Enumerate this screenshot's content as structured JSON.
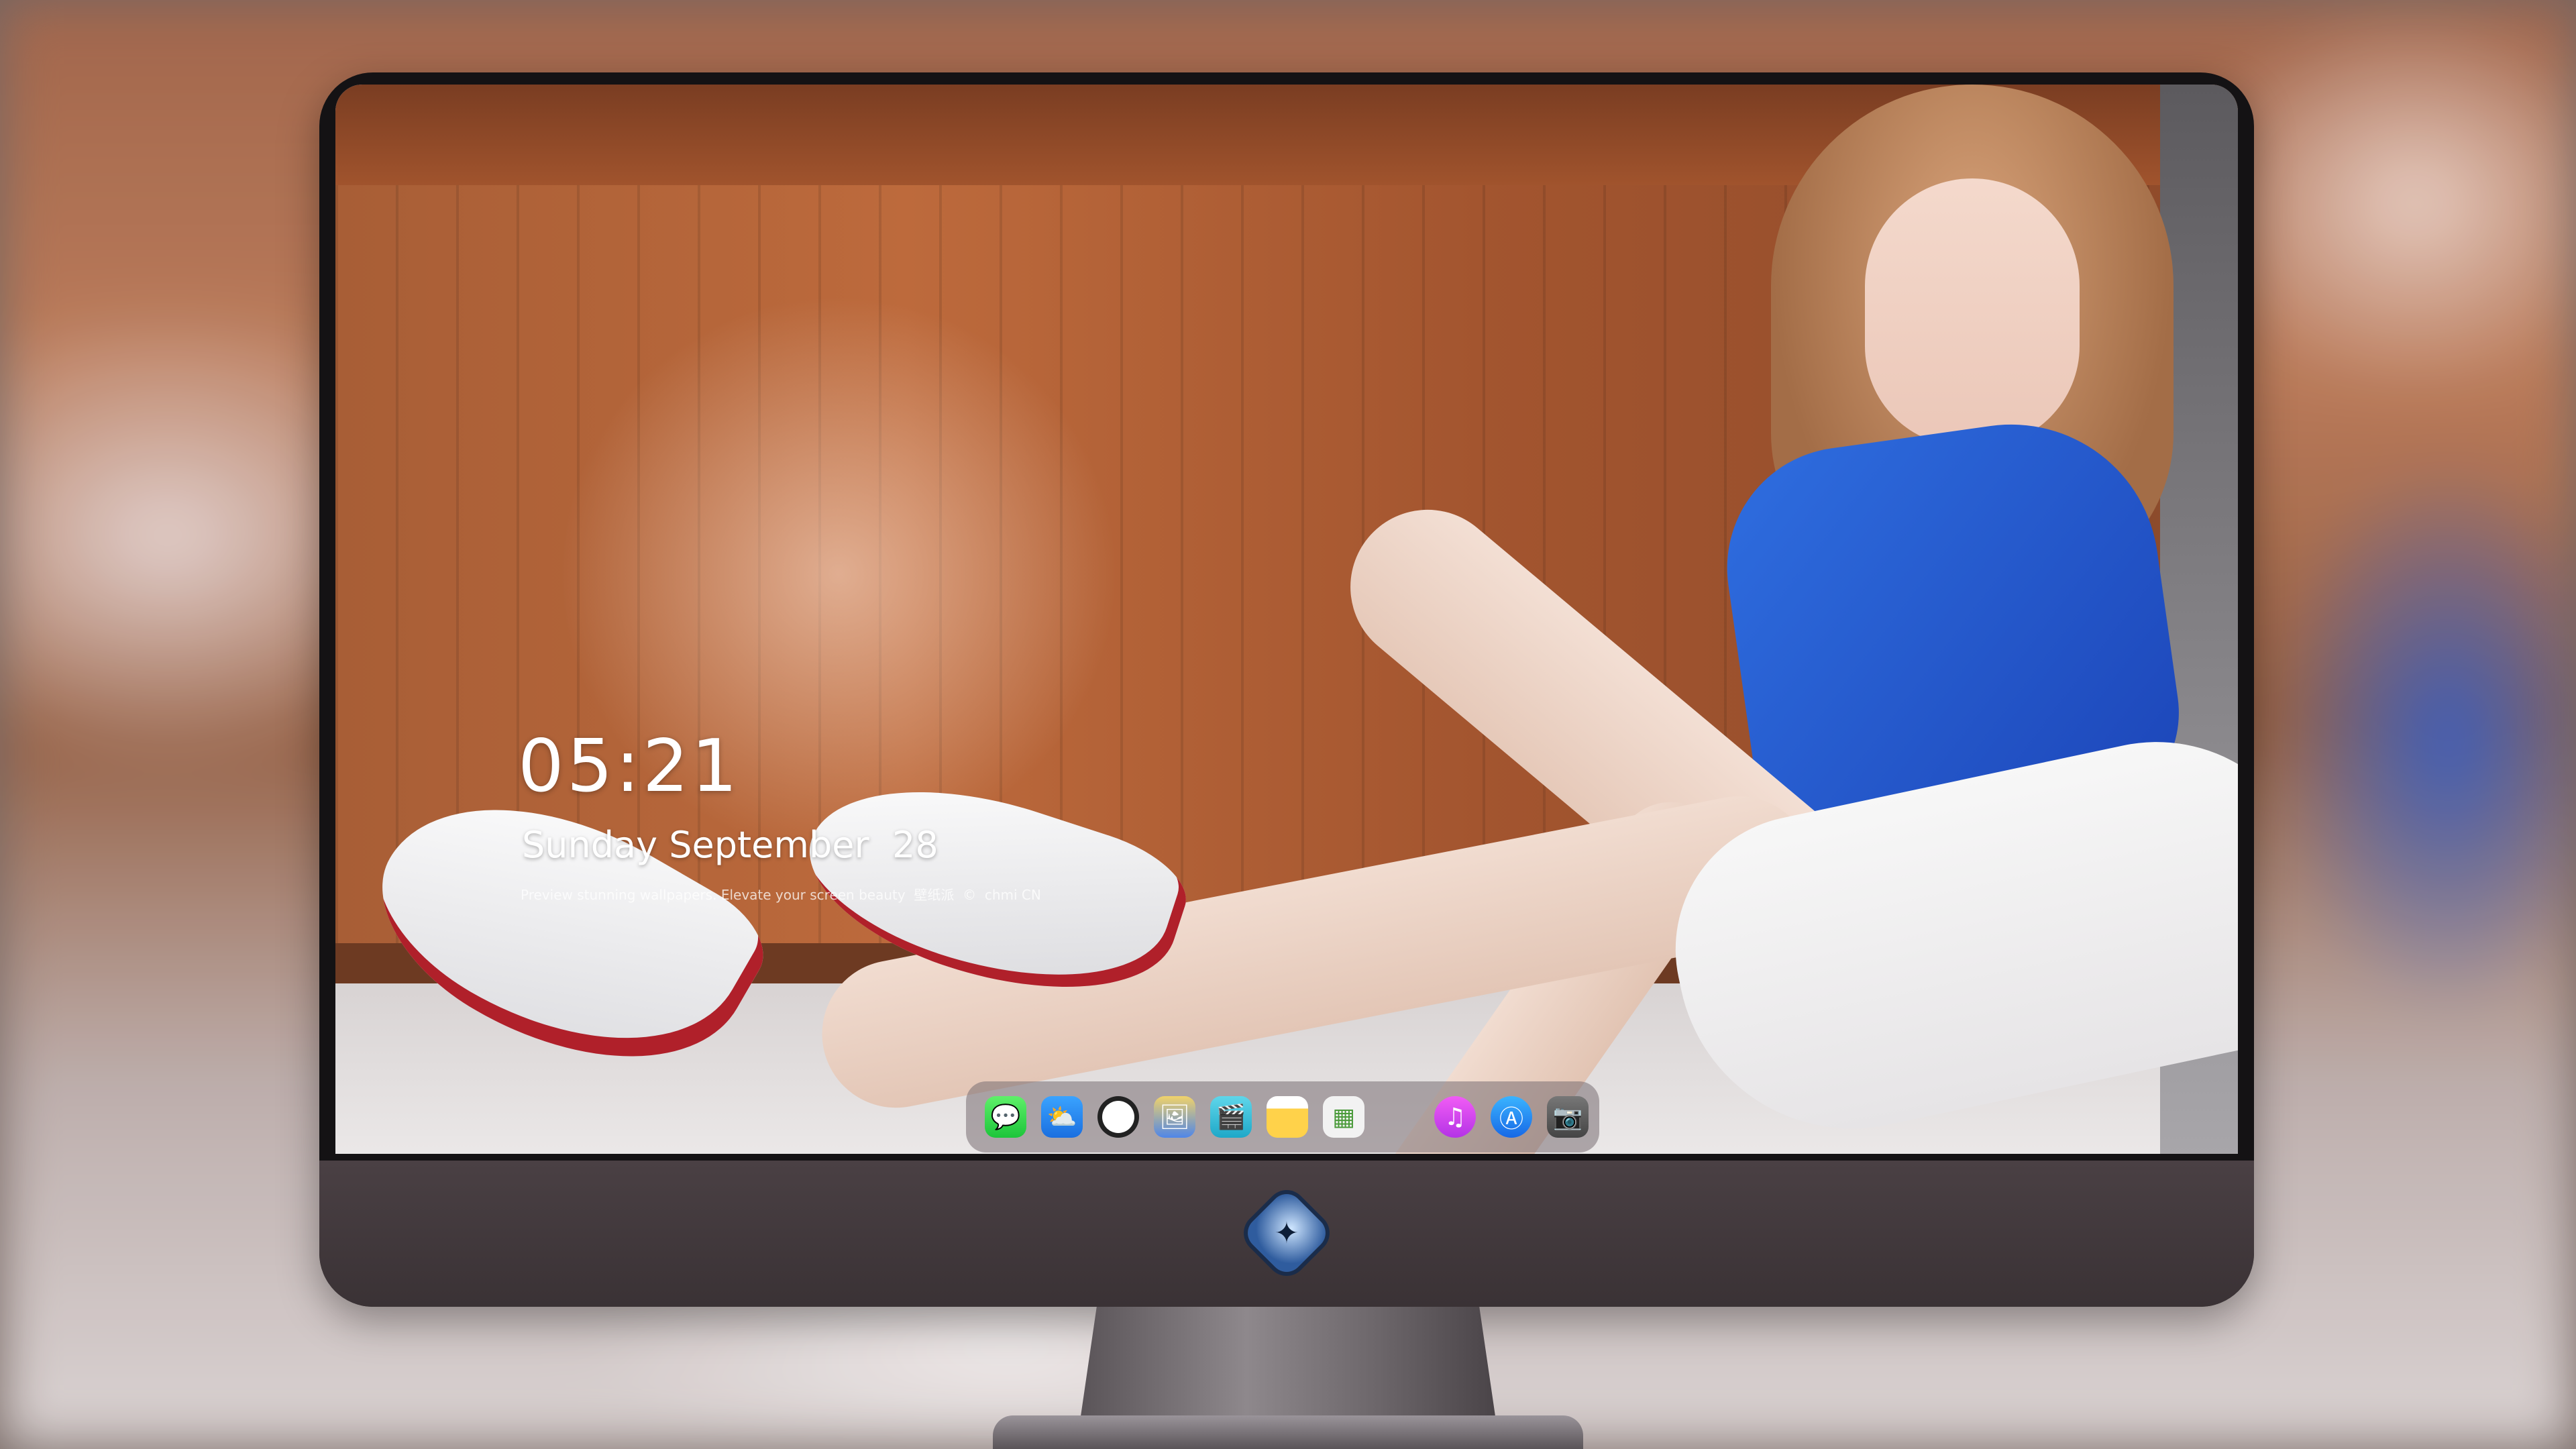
{
  "lockscreen": {
    "time": "05:21",
    "date": "Sunday September  28",
    "tagline": "Preview stunning wallpapers. Elevate your screen beauty  壁纸派  ©  chmi CN"
  },
  "dock": {
    "apps": [
      {
        "name": "messages-icon",
        "glyph": "💬"
      },
      {
        "name": "weather-icon",
        "glyph": "⛅"
      },
      {
        "name": "clock-icon",
        "glyph": ""
      },
      {
        "name": "preview-icon",
        "glyph": "🖼"
      },
      {
        "name": "clips-icon",
        "glyph": "🎬"
      },
      {
        "name": "notes-icon",
        "glyph": ""
      },
      {
        "name": "photos-icon",
        "glyph": "▦"
      }
    ],
    "apps_right": [
      {
        "name": "music-icon",
        "glyph": "♫"
      },
      {
        "name": "app-store-icon",
        "glyph": "Ⓐ"
      },
      {
        "name": "camera-icon",
        "glyph": "📷"
      }
    ]
  },
  "colors": {
    "accent_blue": "#1c45b8",
    "wood": "#a85e36",
    "monitor_chin": "#3a3235"
  }
}
